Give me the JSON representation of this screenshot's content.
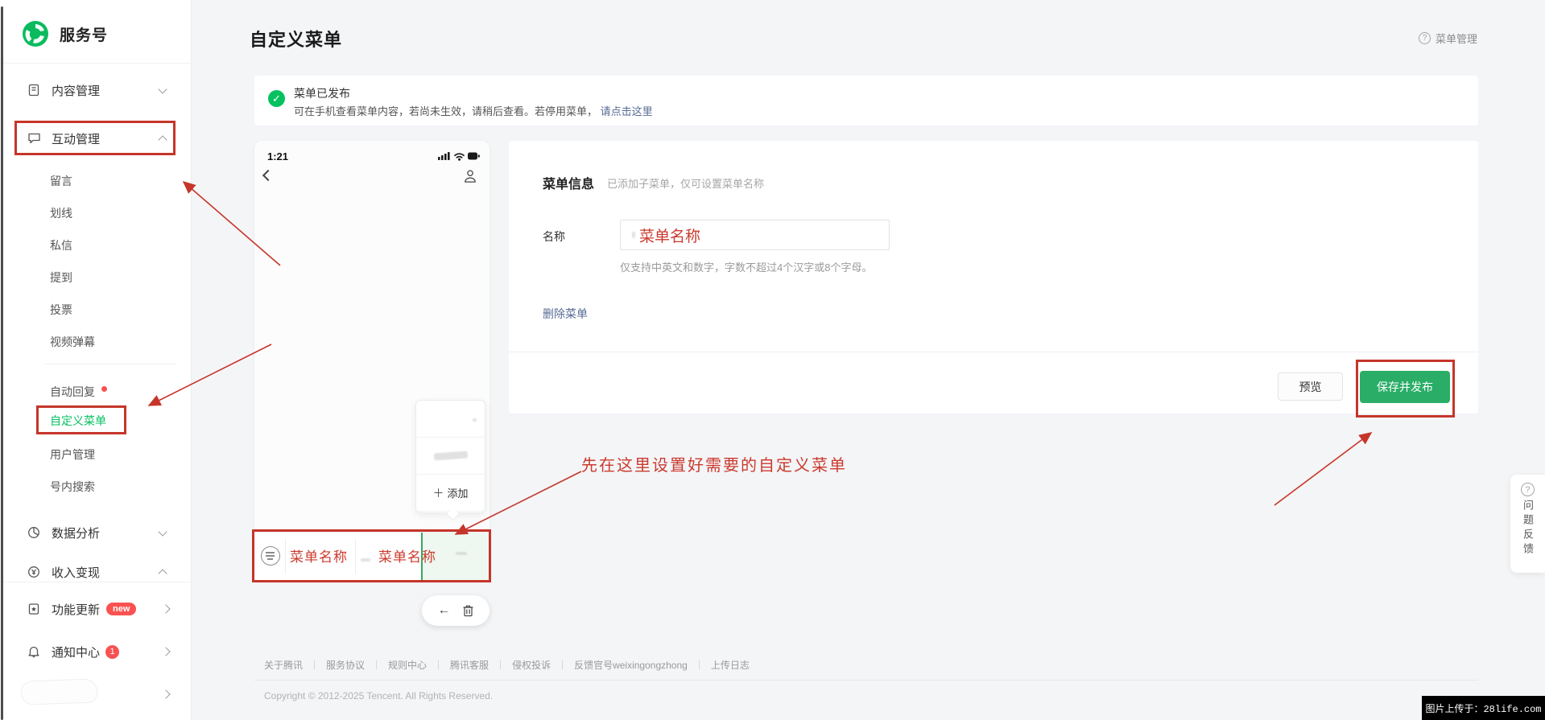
{
  "brand": {
    "name": "服务号"
  },
  "header": {
    "title": "自定义菜单",
    "help": "菜单管理",
    "help_icon": "?"
  },
  "sidebar": {
    "content_mgmt": "内容管理",
    "interact_mgmt": "互动管理",
    "sub": [
      "留言",
      "划线",
      "私信",
      "提到",
      "投票",
      "视频弹幕"
    ],
    "auto_reply": "自动回复",
    "custom_menu": "自定义菜单",
    "user_mgmt": "用户管理",
    "account_search": "号内搜索",
    "data_analysis": "数据分析",
    "monetization": "收入变现",
    "feature_update": "功能更新",
    "feature_badge": "new",
    "notify_center": "通知中心",
    "notify_badge": "1"
  },
  "banner": {
    "title": "菜单已发布",
    "desc": "可在手机查看菜单内容，若尚未生效，请稍后查看。若停用菜单，",
    "link": "请点击这里",
    "check_icon": "✓"
  },
  "phone": {
    "time": "1:21",
    "popup_plus": "＋",
    "popup_add": "添加",
    "menu_item1": "菜单名称",
    "menu_item2": "菜单名称",
    "back_arrow": "←"
  },
  "panel": {
    "section_title": "菜单信息",
    "section_note": "已添加子菜单，仅可设置菜单名称",
    "name_label": "名称",
    "name_value": "菜单名称",
    "name_help": "仅支持中英文和数字，字数不超过4个汉字或8个字母。",
    "delete_link": "删除菜单",
    "preview": "预览",
    "save": "保存并发布"
  },
  "annotation": {
    "tip": "先在这里设置好需要的自定义菜单"
  },
  "feedback": {
    "icon": "?",
    "label": "问题反馈"
  },
  "footer": {
    "links": [
      "关于腾讯",
      "服务协议",
      "规则中心",
      "腾讯客服",
      "侵权投诉",
      "反馈官号weixingongzhong",
      "上传日志"
    ],
    "copyright": "Copyright © 2012-2025 Tencent. All Rights Reserved."
  },
  "watermark": "图片上传于：28life.com",
  "colors": {
    "brand_green": "#07c160",
    "button_green": "#2aae67",
    "annotation_red": "#c6352a",
    "link_blue": "#576b95",
    "badge_red": "#fa5151"
  }
}
